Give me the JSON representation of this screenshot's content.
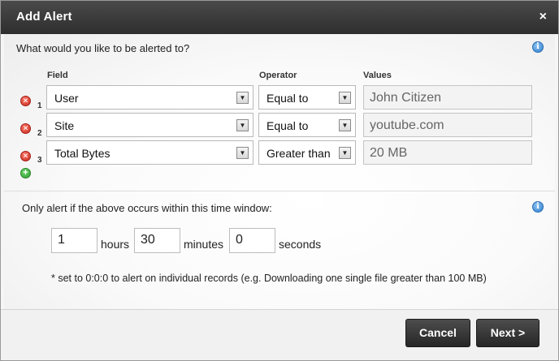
{
  "dialog": {
    "title": "Add Alert",
    "close_glyph": "×"
  },
  "question": "What would you like to be alerted to?",
  "info_icon_glyph": "i",
  "columns": {
    "field": "Field",
    "operator": "Operator",
    "values": "Values"
  },
  "rows": [
    {
      "num": "1",
      "field": "User",
      "operator": "Equal to",
      "value": "John Citizen"
    },
    {
      "num": "2",
      "field": "Site",
      "operator": "Equal to",
      "value": "youtube.com"
    },
    {
      "num": "3",
      "field": "Total Bytes",
      "operator": "Greater than",
      "value": "20 MB"
    }
  ],
  "window": {
    "label": "Only alert if the above occurs within this time window:",
    "hours_value": "1",
    "hours_label": "hours",
    "minutes_value": "30",
    "minutes_label": "minutes",
    "seconds_value": "0",
    "seconds_label": "seconds",
    "note": "* set to 0:0:0 to alert on individual records (e.g. Downloading one single file greater than 100 MB)"
  },
  "buttons": {
    "cancel": "Cancel",
    "next": "Next >"
  },
  "glyphs": {
    "remove": "✕",
    "add": "+",
    "dropdown": "▼"
  },
  "colors": {
    "titlebar": "#3a3a3a",
    "remove": "#d0301f",
    "add": "#3aa83a",
    "info": "#3a8bd6"
  }
}
